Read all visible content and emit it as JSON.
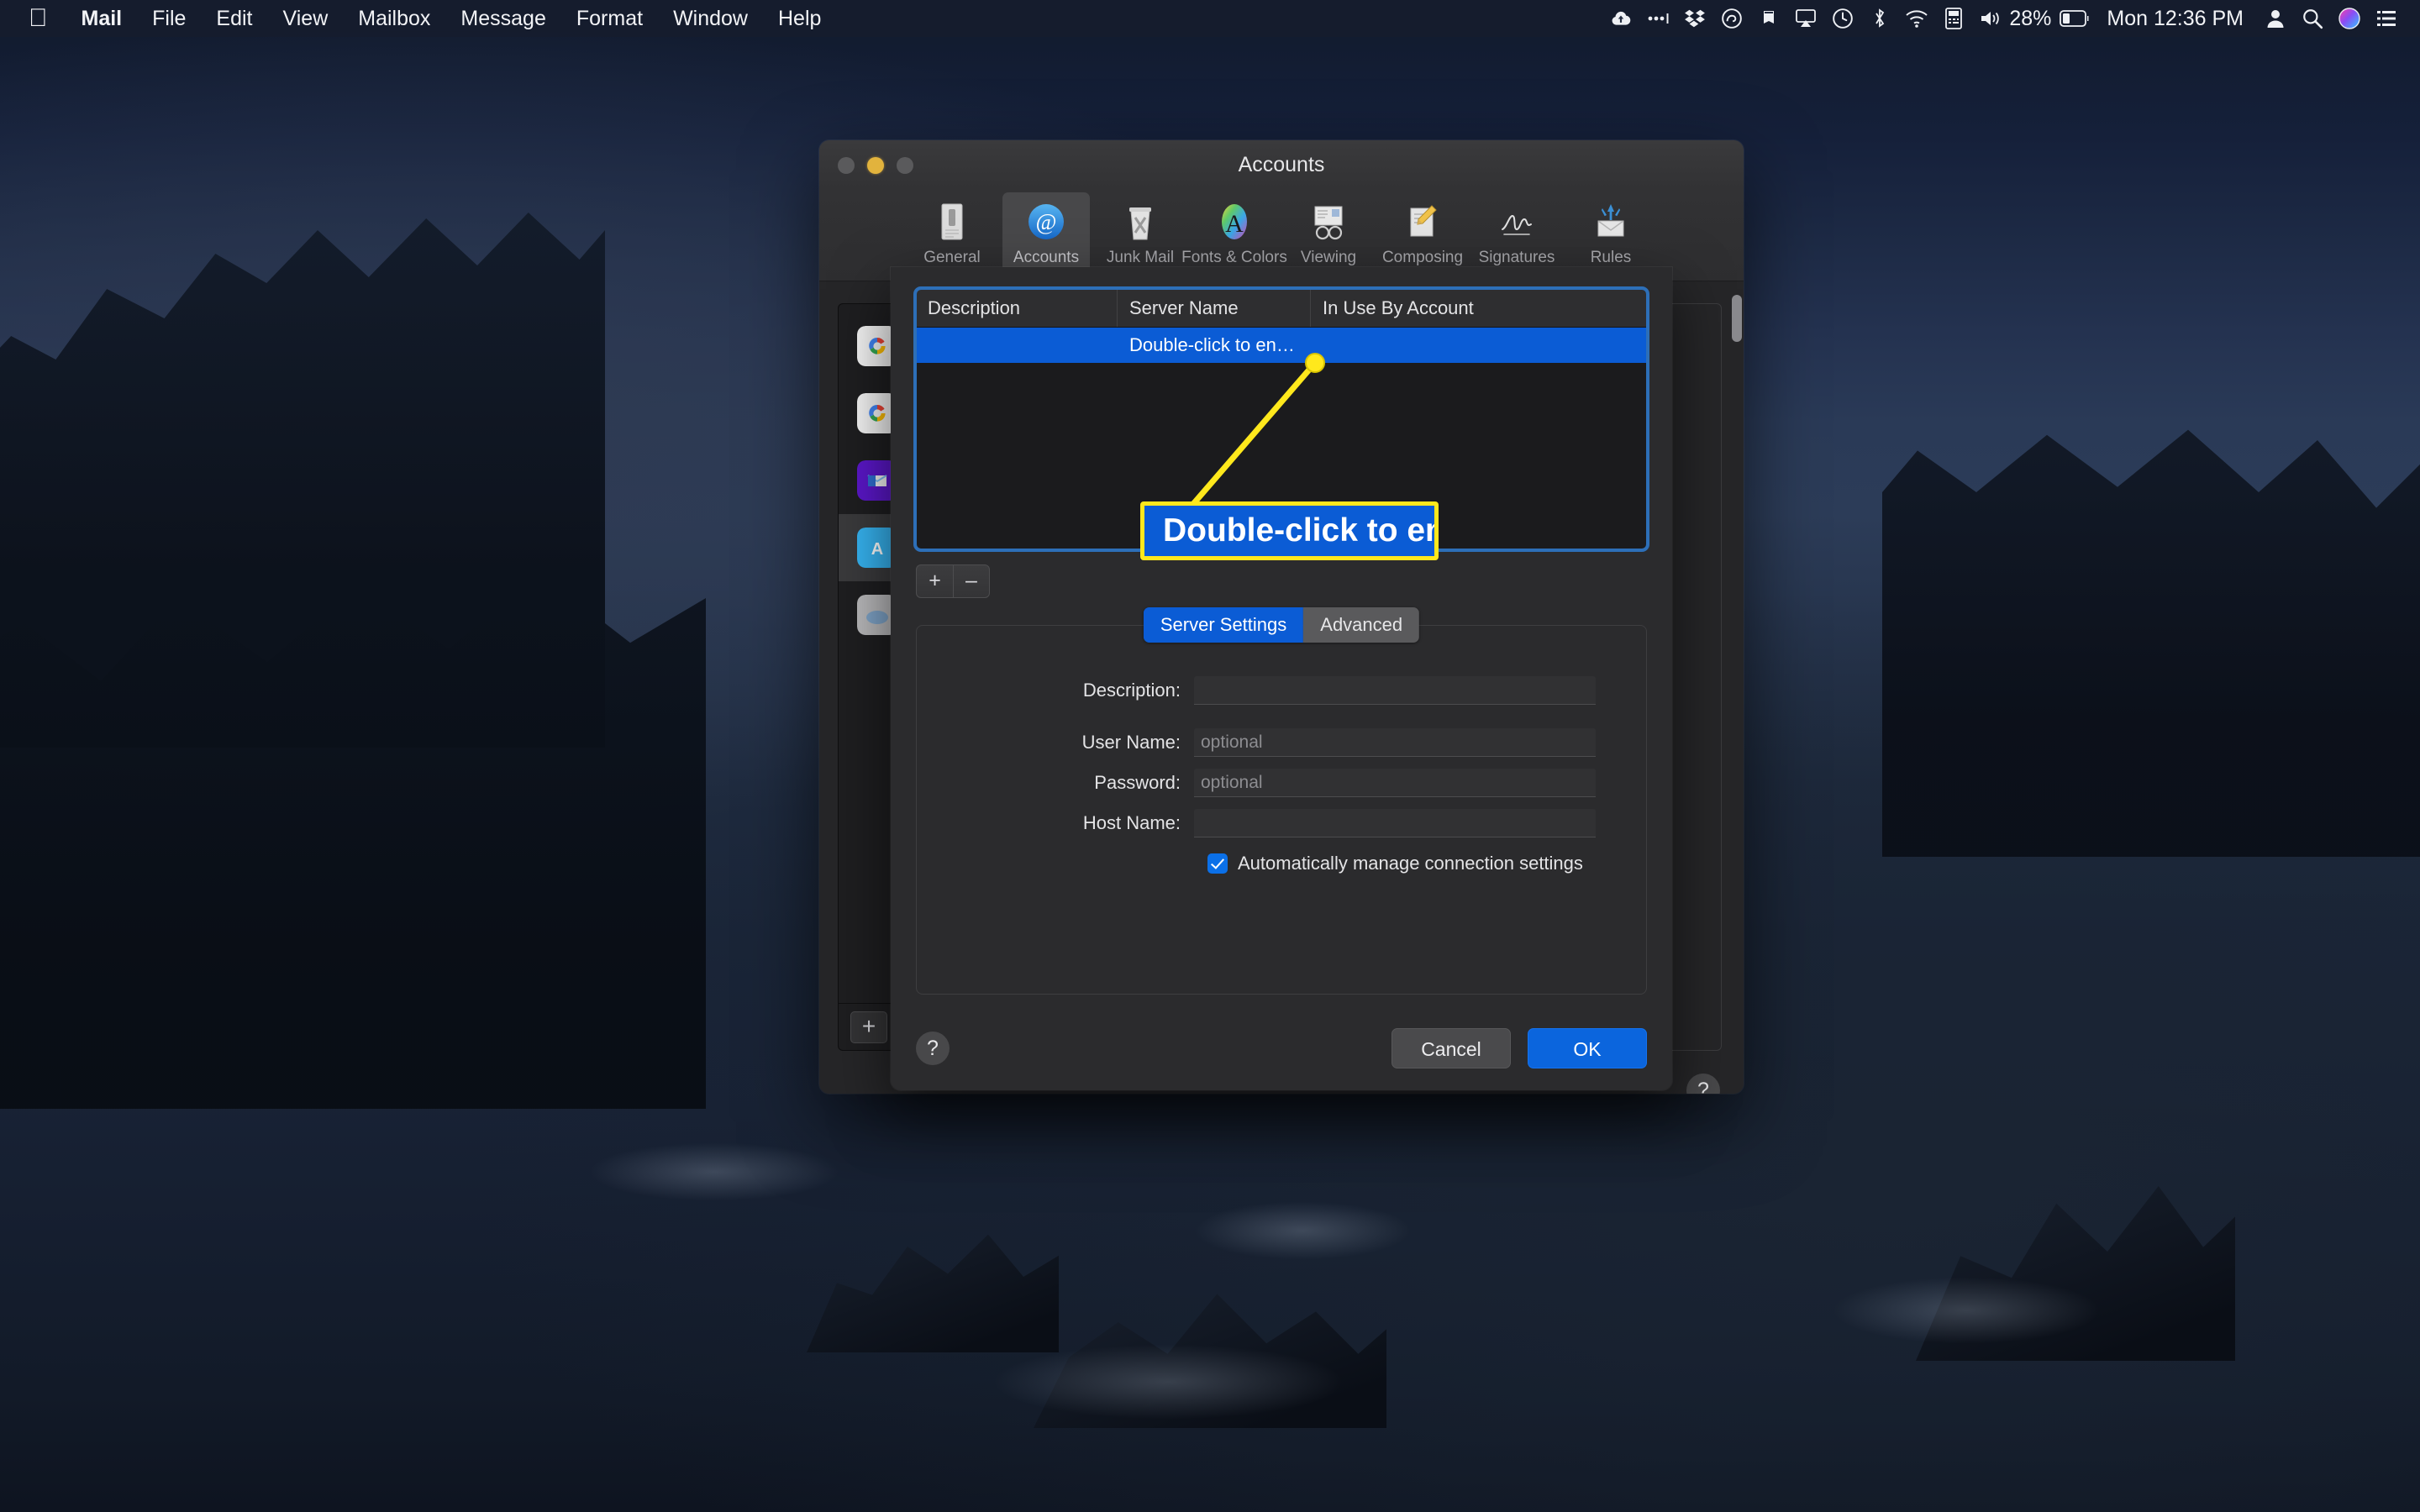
{
  "menubar": {
    "apple_logo": "apple-logo",
    "app_name": "Mail",
    "menus": [
      "File",
      "Edit",
      "View",
      "Mailbox",
      "Message",
      "Format",
      "Window",
      "Help"
    ],
    "status_icons": [
      "cloud-upload-icon",
      "three-dots-icon",
      "dropbox-icon",
      "adobe-creative-cloud-icon",
      "notification-bell-icon",
      "airplay-icon",
      "time-machine-icon",
      "bluetooth-icon",
      "wifi-icon",
      "input-source-icon",
      "volume-icon"
    ],
    "battery_percent": "28%",
    "clock": "Mon 12:36 PM",
    "trailing_icons": [
      "user-account-icon",
      "search-icon",
      "siri-icon",
      "control-center-icon"
    ]
  },
  "prefs_window": {
    "title": "Accounts",
    "traffic_lights": [
      "close-button",
      "minimize-button",
      "zoom-button"
    ],
    "toolbar": [
      {
        "label": "General",
        "icon": "general-icon",
        "selected": false
      },
      {
        "label": "Accounts",
        "icon": "accounts-at-icon",
        "selected": true
      },
      {
        "label": "Junk Mail",
        "icon": "junk-mail-icon",
        "selected": false
      },
      {
        "label": "Fonts & Colors",
        "icon": "fonts-colors-icon",
        "selected": false
      },
      {
        "label": "Viewing",
        "icon": "viewing-icon",
        "selected": false
      },
      {
        "label": "Composing",
        "icon": "composing-icon",
        "selected": false
      },
      {
        "label": "Signatures",
        "icon": "signatures-icon",
        "selected": false
      },
      {
        "label": "Rules",
        "icon": "rules-icon",
        "selected": false
      }
    ],
    "accounts_sidebar": {
      "accounts": [
        {
          "icon": "google-account-icon",
          "selected": false
        },
        {
          "icon": "google-account-icon",
          "selected": false
        },
        {
          "icon": "outlook-account-icon",
          "selected": false
        },
        {
          "icon": "aol-account-icon",
          "selected": true
        },
        {
          "icon": "icloud-account-icon",
          "selected": false
        }
      ],
      "add_button_label": "+"
    },
    "help_button_label": "?"
  },
  "sheet": {
    "table": {
      "columns": [
        "Description",
        "Server Name",
        "In Use By Account"
      ],
      "rows": [
        {
          "description": "",
          "server_name": "Double-click to en…",
          "in_use_by_account": "",
          "selected": true
        }
      ]
    },
    "table_buttons": {
      "add": "+",
      "remove": "–"
    },
    "tabs": [
      {
        "label": "Server Settings",
        "active": true
      },
      {
        "label": "Advanced",
        "active": false
      }
    ],
    "fields": [
      {
        "label": "Description:",
        "value": "",
        "placeholder": ""
      },
      {
        "label": "User Name:",
        "value": "",
        "placeholder": "optional"
      },
      {
        "label": "Password:",
        "value": "",
        "placeholder": "optional"
      },
      {
        "label": "Host Name:",
        "value": "",
        "placeholder": ""
      }
    ],
    "checkbox": {
      "label": "Automatically manage connection settings",
      "checked": true
    },
    "help_button_label": "?",
    "buttons": {
      "cancel": "Cancel",
      "ok": "OK"
    }
  },
  "callout": {
    "text": "Double-click to en…",
    "border_color": "#ffe81c",
    "fill_color": "#0b5cd5"
  }
}
